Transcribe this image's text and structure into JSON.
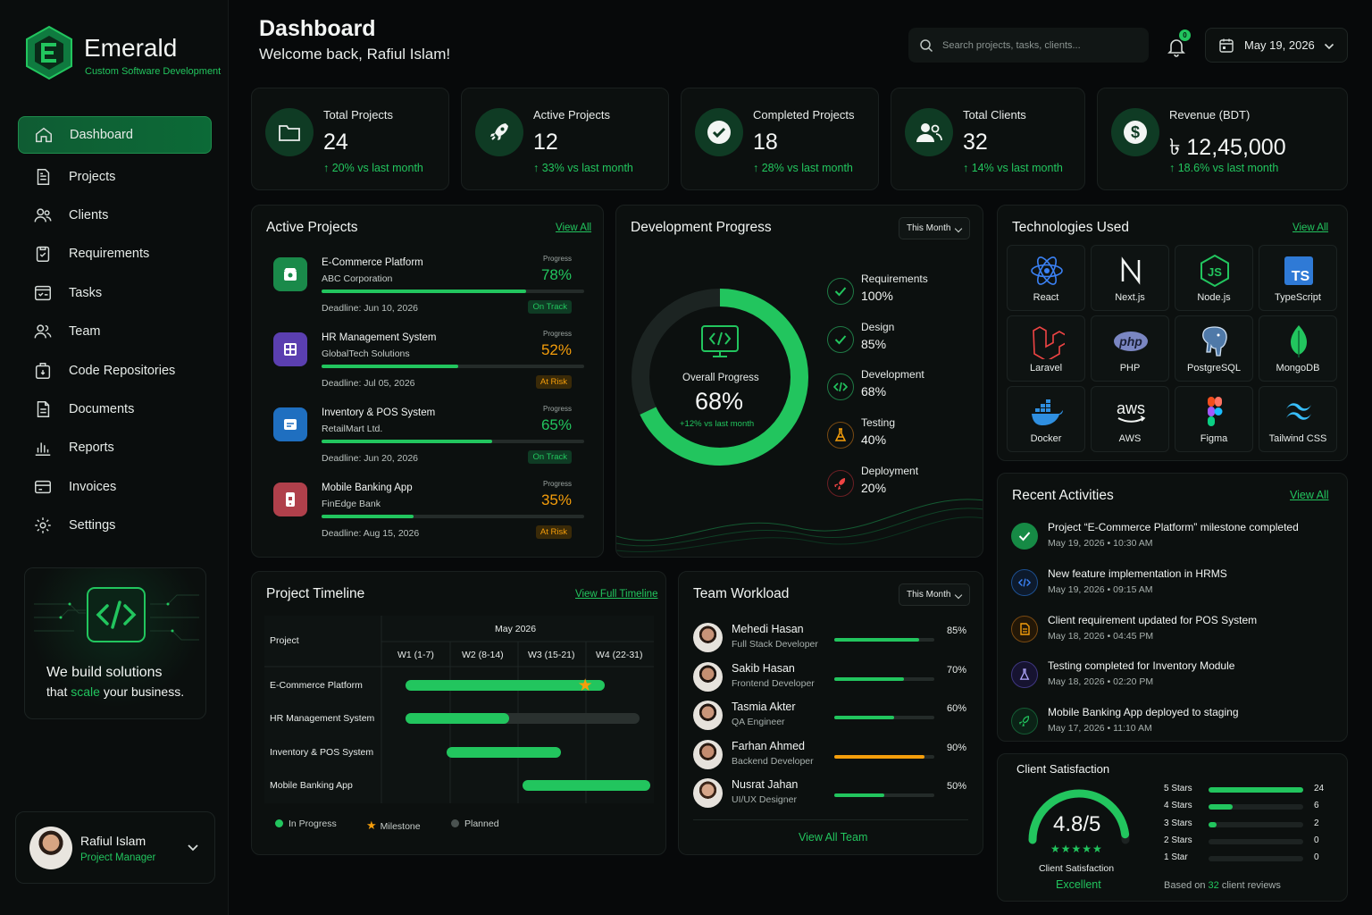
{
  "brand": {
    "name": "Emerald",
    "tagline": "Custom Software Development"
  },
  "nav": [
    {
      "label": "Dashboard",
      "icon": "home-icon",
      "active": true
    },
    {
      "label": "Projects",
      "icon": "document-icon"
    },
    {
      "label": "Clients",
      "icon": "users-icon"
    },
    {
      "label": "Requirements",
      "icon": "clipboard-icon"
    },
    {
      "label": "Tasks",
      "icon": "tasks-icon"
    },
    {
      "label": "Team",
      "icon": "team-icon"
    },
    {
      "label": "Code Repositories",
      "icon": "repository-icon"
    },
    {
      "label": "Documents",
      "icon": "file-icon"
    },
    {
      "label": "Reports",
      "icon": "bar-chart-icon"
    },
    {
      "label": "Invoices",
      "icon": "invoice-icon"
    },
    {
      "label": "Settings",
      "icon": "gear-icon"
    }
  ],
  "promo": {
    "line1": "We build solutions",
    "line2_pre": "that ",
    "line2_accent": "scale",
    "line2_post": " your business."
  },
  "user": {
    "name": "Rafiul Islam",
    "role": "Project Manager"
  },
  "header": {
    "title": "Dashboard",
    "welcome": "Welcome back, Rafiul Islam!",
    "search_placeholder": "Search projects, tasks, clients...",
    "notifications": "0",
    "date": "May 19, 2026"
  },
  "stats": [
    {
      "label": "Total Projects",
      "value": "24",
      "delta": "20% vs last month",
      "icon": "folder-icon"
    },
    {
      "label": "Active Projects",
      "value": "12",
      "delta": "33% vs last month",
      "icon": "rocket-icon"
    },
    {
      "label": "Completed Projects",
      "value": "18",
      "delta": "28% vs last month",
      "icon": "check-icon"
    },
    {
      "label": "Total Clients",
      "value": "32",
      "delta": "14% vs last month",
      "icon": "users-icon"
    },
    {
      "label": "Revenue (BDT)",
      "value": "৳ 12,45,000",
      "delta": "18.6% vs last month",
      "icon": "dollar-icon"
    }
  ],
  "active_projects": {
    "title": "Active Projects",
    "view_all": "View All",
    "progress_label": "Progress",
    "items": [
      {
        "name": "E-Commerce Platform",
        "client": "ABC Corporation",
        "progress": 78,
        "pct": "78%",
        "deadline": "Deadline: Jun 10, 2026",
        "status": "On Track",
        "color": "#1a8a4a",
        "icon": "store-icon"
      },
      {
        "name": "HR Management System",
        "client": "GlobalTech Solutions",
        "progress": 52,
        "pct": "52%",
        "deadline": "Deadline: Jul 05, 2026",
        "status": "At Risk",
        "color": "#5b3fb0",
        "icon": "hr-icon"
      },
      {
        "name": "Inventory & POS System",
        "client": "RetailMart Ltd.",
        "progress": 65,
        "pct": "65%",
        "deadline": "Deadline: Jun 20, 2026",
        "status": "On Track",
        "color": "#1f6fc0",
        "icon": "pos-icon"
      },
      {
        "name": "Mobile Banking App",
        "client": "FinEdge Bank",
        "progress": 35,
        "pct": "35%",
        "deadline": "Deadline: Aug 15, 2026",
        "status": "At Risk",
        "color": "#b0404b",
        "icon": "mobile-icon"
      }
    ]
  },
  "dev_progress": {
    "title": "Development Progress",
    "period": "This Month",
    "overall_label": "Overall Progress",
    "overall": 68,
    "overall_text": "68%",
    "overall_delta": "+12% vs last month",
    "steps": [
      {
        "name": "Requirements",
        "value": "100%",
        "icon": "check-icon"
      },
      {
        "name": "Design",
        "value": "85%",
        "icon": "check-icon"
      },
      {
        "name": "Development",
        "value": "68%",
        "icon": "code-icon"
      },
      {
        "name": "Testing",
        "value": "40%",
        "icon": "flask-icon"
      },
      {
        "name": "Deployment",
        "value": "20%",
        "icon": "rocket-icon"
      }
    ]
  },
  "technologies": {
    "title": "Technologies Used",
    "view_all": "View All",
    "items": [
      "React",
      "Next.js",
      "Node.js",
      "TypeScript",
      "Laravel",
      "PHP",
      "PostgreSQL",
      "MongoDB",
      "Docker",
      "AWS",
      "Figma",
      "Tailwind CSS"
    ]
  },
  "activities": {
    "title": "Recent Activities",
    "view_all": "View All",
    "items": [
      {
        "text": "Project “E-Commerce Platform” milestone completed",
        "date": "May 19, 2026  •  10:30 AM",
        "icon": "check-icon",
        "color": "#22c55e"
      },
      {
        "text": "New feature implementation in HRMS",
        "date": "May 19, 2026  •  09:15 AM",
        "icon": "code-icon",
        "color": "#3b82f6"
      },
      {
        "text": "Client requirement updated for POS System",
        "date": "May 18, 2026  •  04:45 PM",
        "icon": "document-icon",
        "color": "#f59e0b"
      },
      {
        "text": "Testing completed for Inventory Module",
        "date": "May 18, 2026  •  02:20 PM",
        "icon": "flask-icon",
        "color": "#8b7cf6"
      },
      {
        "text": "Mobile Banking App deployed to staging",
        "date": "May 17, 2026  •  11:10 AM",
        "icon": "rocket-icon",
        "color": "#22c55e"
      }
    ]
  },
  "timeline": {
    "title": "Project Timeline",
    "view_full": "View Full Timeline",
    "project_header": "Project",
    "month": "May 2026",
    "weeks": [
      "W1 (1-7)",
      "W2 (8-14)",
      "W3 (15-21)",
      "W4 (22-31)"
    ],
    "rows": [
      {
        "name": "E-Commerce Platform",
        "start": 0.05,
        "end": 0.82,
        "milestone": 0.72
      },
      {
        "name": "HR Management System",
        "start": 0.05,
        "end": 0.47,
        "planned_end": 1.0
      },
      {
        "name": "Inventory & POS System",
        "start": 0.2,
        "end": 0.66
      },
      {
        "name": "Mobile Banking App",
        "start": 0.48,
        "end": 1.0
      }
    ],
    "legend": {
      "in_progress": "In Progress",
      "milestone": "Milestone",
      "planned": "Planned"
    }
  },
  "workload": {
    "title": "Team Workload",
    "period": "This Month",
    "view_all": "View All Team",
    "members": [
      {
        "name": "Mehedi Hasan",
        "role": "Full Stack Developer",
        "load": 85,
        "pct": "85%",
        "color": "#22c55e"
      },
      {
        "name": "Sakib Hasan",
        "role": "Frontend Developer",
        "load": 70,
        "pct": "70%",
        "color": "#22c55e"
      },
      {
        "name": "Tasmia Akter",
        "role": "QA Engineer",
        "load": 60,
        "pct": "60%",
        "color": "#22c55e"
      },
      {
        "name": "Farhan Ahmed",
        "role": "Backend Developer",
        "load": 90,
        "pct": "90%",
        "color": "#f59e0b"
      },
      {
        "name": "Nusrat Jahan",
        "role": "UI/UX Designer",
        "load": 50,
        "pct": "50%",
        "color": "#22c55e"
      }
    ]
  },
  "satisfaction": {
    "title": "Client Satisfaction",
    "score": "4.8/5",
    "score_value": 4.8,
    "stars": "★★★★★",
    "caption": "Client Satisfaction",
    "rating": "Excellent",
    "breakdown": [
      {
        "label": "5 Stars",
        "count": 24
      },
      {
        "label": "4 Stars",
        "count": 6
      },
      {
        "label": "3 Stars",
        "count": 2
      },
      {
        "label": "2 Stars",
        "count": 0
      },
      {
        "label": "1 Star",
        "count": 0
      }
    ],
    "based_pre": "Based on ",
    "based_count": "32",
    "based_post": " client reviews"
  }
}
